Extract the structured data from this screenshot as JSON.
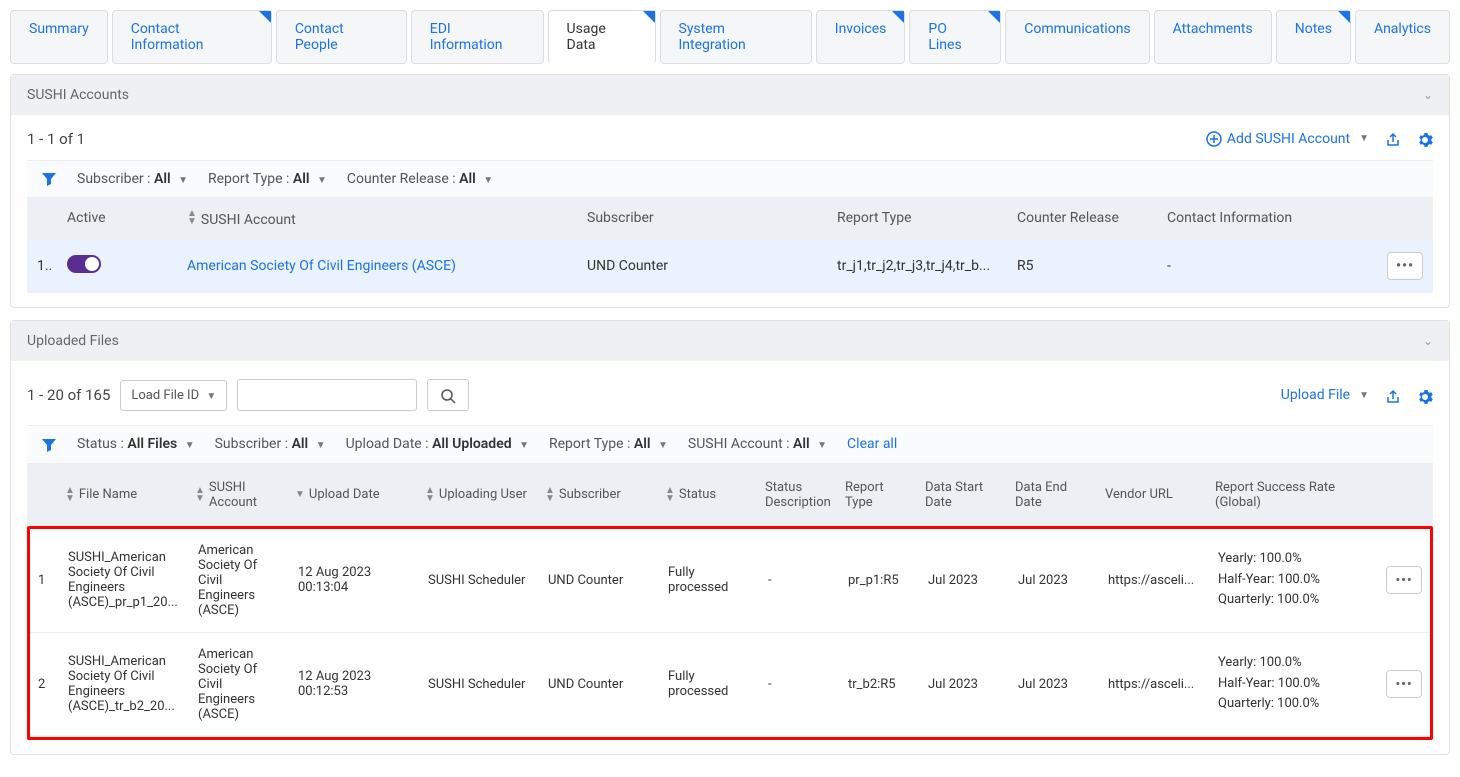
{
  "tabs": [
    {
      "label": "Summary",
      "corner": false
    },
    {
      "label": "Contact Information",
      "corner": true
    },
    {
      "label": "Contact People",
      "corner": false
    },
    {
      "label": "EDI Information",
      "corner": false
    },
    {
      "label": "Usage Data",
      "corner": true,
      "active": true
    },
    {
      "label": "System Integration",
      "corner": false
    },
    {
      "label": "Invoices",
      "corner": true
    },
    {
      "label": "PO Lines",
      "corner": true
    },
    {
      "label": "Communications",
      "corner": false
    },
    {
      "label": "Attachments",
      "corner": false
    },
    {
      "label": "Notes",
      "corner": true
    },
    {
      "label": "Analytics",
      "corner": false
    }
  ],
  "sushi_panel": {
    "title": "SUSHI Accounts",
    "count": "1 - 1 of 1",
    "add_label": "Add SUSHI Account",
    "filters": {
      "subscriber_label": "Subscriber :",
      "subscriber_val": "All",
      "report_type_label": "Report Type :",
      "report_type_val": "All",
      "counter_release_label": "Counter Release :",
      "counter_release_val": "All"
    },
    "columns": {
      "active": "Active",
      "sushi_account": "SUSHI Account",
      "subscriber": "Subscriber",
      "report_type": "Report Type",
      "counter_release": "Counter Release",
      "contact_info": "Contact Information"
    },
    "row": {
      "num": "1..",
      "account": "American Society Of Civil Engineers (ASCE)",
      "subscriber": "UND Counter",
      "report_type": "tr_j1,tr_j2,tr_j3,tr_j4,tr_b...",
      "counter_release": "R5",
      "contact_info": "-"
    }
  },
  "uploaded_panel": {
    "title": "Uploaded Files",
    "count": "1 - 20 of 165",
    "load_file_label": "Load File ID",
    "upload_file_label": "Upload File",
    "filters": {
      "status_label": "Status :",
      "status_val": "All Files",
      "subscriber_label": "Subscriber :",
      "subscriber_val": "All",
      "upload_date_label": "Upload Date :",
      "upload_date_val": "All Uploaded",
      "report_type_label": "Report Type :",
      "report_type_val": "All",
      "sushi_account_label": "SUSHI Account :",
      "sushi_account_val": "All",
      "clear_all": "Clear all"
    },
    "columns": {
      "file_name": "File Name",
      "sushi_account": "SUSHI Account",
      "upload_date": "Upload Date",
      "uploading_user": "Uploading User",
      "subscriber": "Subscriber",
      "status": "Status",
      "status_desc": "Status Description",
      "report_type": "Report Type",
      "data_start": "Data Start Date",
      "data_end": "Data End Date",
      "vendor_url": "Vendor URL",
      "success_rate": "Report Success Rate (Global)"
    },
    "rows": [
      {
        "num": "1",
        "file_name": "SUSHI_American Society Of Civil Engineers (ASCE)_pr_p1_20...",
        "sushi_account": "American Society Of Civil Engineers (ASCE)",
        "upload_date": "12 Aug 2023 00:13:04",
        "uploading_user": "SUSHI Scheduler",
        "subscriber": "UND Counter",
        "status": "Fully processed",
        "status_desc": "-",
        "report_type": "pr_p1:R5",
        "data_start": "Jul 2023",
        "data_end": "Jul 2023",
        "vendor_url": "https://asceli...",
        "success_yearly": "Yearly: 100.0%",
        "success_half": "Half-Year: 100.0%",
        "success_quarterly": "Quarterly: 100.0%"
      },
      {
        "num": "2",
        "file_name": "SUSHI_American Society Of Civil Engineers (ASCE)_tr_b2_20...",
        "sushi_account": "American Society Of Civil Engineers (ASCE)",
        "upload_date": "12 Aug 2023 00:12:53",
        "uploading_user": "SUSHI Scheduler",
        "subscriber": "UND Counter",
        "status": "Fully processed",
        "status_desc": "-",
        "report_type": "tr_b2:R5",
        "data_start": "Jul 2023",
        "data_end": "Jul 2023",
        "vendor_url": "https://asceli...",
        "success_yearly": "Yearly: 100.0%",
        "success_half": "Half-Year: 100.0%",
        "success_quarterly": "Quarterly: 100.0%"
      }
    ]
  }
}
